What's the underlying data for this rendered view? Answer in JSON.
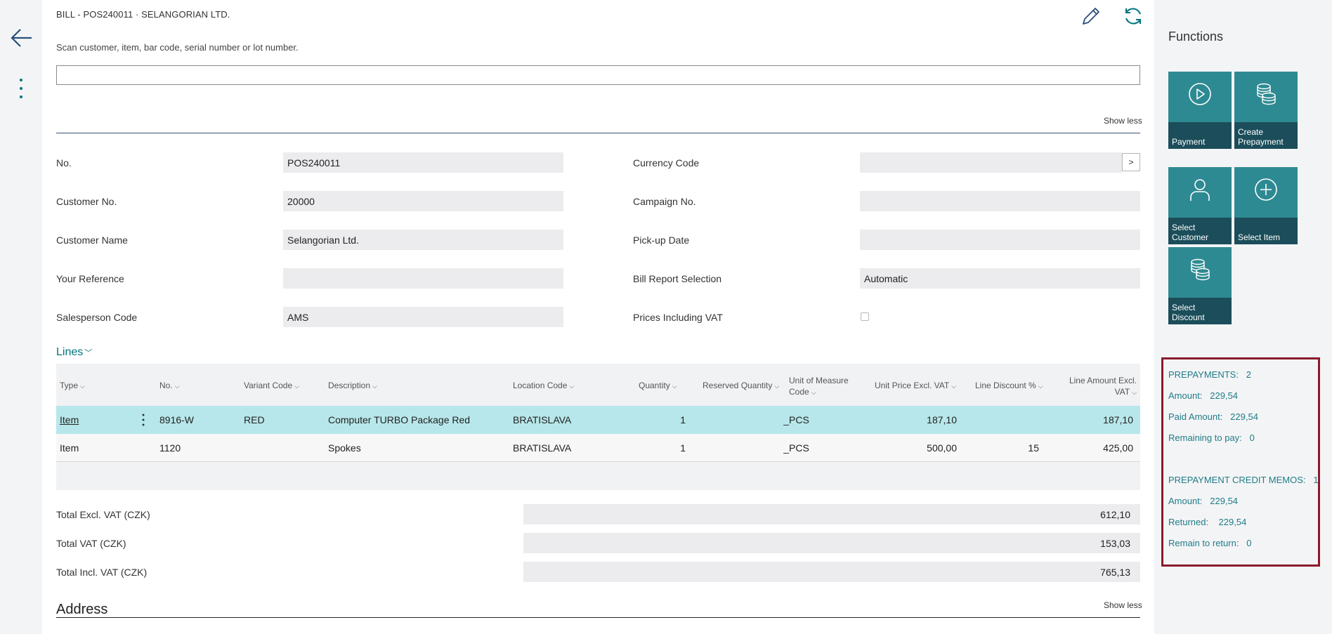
{
  "header": {
    "caption": "BILL - POS240011 · SELANGORIAN LTD.",
    "scan_label": "Scan customer, item, bar code, serial number or lot number.",
    "scan_value": "",
    "show_less": "Show less"
  },
  "fields": {
    "no": {
      "label": "No.",
      "value": "POS240011"
    },
    "customer_no": {
      "label": "Customer No.",
      "value": "20000"
    },
    "customer_name": {
      "label": "Customer Name",
      "value": "Selangorian Ltd."
    },
    "your_reference": {
      "label": "Your Reference",
      "value": ""
    },
    "salesperson_code": {
      "label": "Salesperson Code",
      "value": "AMS"
    },
    "currency_code": {
      "label": "Currency Code",
      "value": "",
      "lookup": ">"
    },
    "campaign_no": {
      "label": "Campaign No.",
      "value": ""
    },
    "pickup_date": {
      "label": "Pick-up Date",
      "value": ""
    },
    "bill_report_selection": {
      "label": "Bill Report Selection",
      "value": "Automatic"
    },
    "prices_including_vat": {
      "label": "Prices Including VAT",
      "checked": false
    }
  },
  "lines": {
    "title": "Lines",
    "columns": {
      "type": "Type",
      "no": "No.",
      "variant_code": "Variant Code",
      "description": "Description",
      "location_code": "Location Code",
      "quantity": "Quantity",
      "reserved_quantity": "Reserved Quantity",
      "uom_line1": "Unit of Measure",
      "uom_line2": "Code",
      "unit_price": "Unit Price Excl. VAT",
      "line_discount": "Line Discount %",
      "line_amount_line1": "Line Amount Excl.",
      "line_amount_line2": "VAT"
    },
    "rows": [
      {
        "type": "Item",
        "no": "8916-W",
        "variant": "RED",
        "description": "Computer TURBO Package Red",
        "location": "BRATISLAVA",
        "quantity": "1",
        "reserved": "_",
        "uom": "PCS",
        "unit_price": "187,10",
        "discount": "",
        "amount": "187,10"
      },
      {
        "type": "Item",
        "no": "1120",
        "variant": "",
        "description": "Spokes",
        "location": "BRATISLAVA",
        "quantity": "1",
        "reserved": "_",
        "uom": "PCS",
        "unit_price": "500,00",
        "discount": "15",
        "amount": "425,00"
      }
    ]
  },
  "totals": {
    "excl_vat": {
      "label": "Total Excl. VAT (CZK)",
      "value": "612,10"
    },
    "vat": {
      "label": "Total VAT (CZK)",
      "value": "153,03"
    },
    "incl_vat": {
      "label": "Total Incl. VAT (CZK)",
      "value": "765,13"
    }
  },
  "address": {
    "title": "Address",
    "show_less": "Show less"
  },
  "functions": {
    "title": "Functions",
    "tiles": [
      {
        "label": "Payment",
        "icon": "play-circle-icon"
      },
      {
        "label": "Create Prepayment",
        "icon": "coins-icon"
      },
      {
        "label": "Select Customer",
        "icon": "person-icon"
      },
      {
        "label": "Select Item",
        "icon": "plus-circle-icon"
      },
      {
        "label": "Select Discount",
        "icon": "coins-icon"
      }
    ]
  },
  "prepayments": {
    "header_label": "PREPAYMENTS:",
    "header_value": "2",
    "amount_label": "Amount:",
    "amount_value": "229,54",
    "paid_label": "Paid Amount:",
    "paid_value": "229,54",
    "remaining_label": "Remaining to pay:",
    "remaining_value": "0",
    "credit_label": "PREPAYMENT CREDIT MEMOS:",
    "credit_value": "1",
    "credit_amount_label": "Amount:",
    "credit_amount_value": "229,54",
    "returned_label": "Returned:",
    "returned_value": "229,54",
    "remain_return_label": "Remain to return:",
    "remain_return_value": "0"
  },
  "colors": {
    "accent": "#00747c",
    "tile": "#2e8a92",
    "tile_label": "#1b4d5a",
    "selected_row": "#b7e7ea",
    "highlight_box": "#8b1a2b"
  }
}
